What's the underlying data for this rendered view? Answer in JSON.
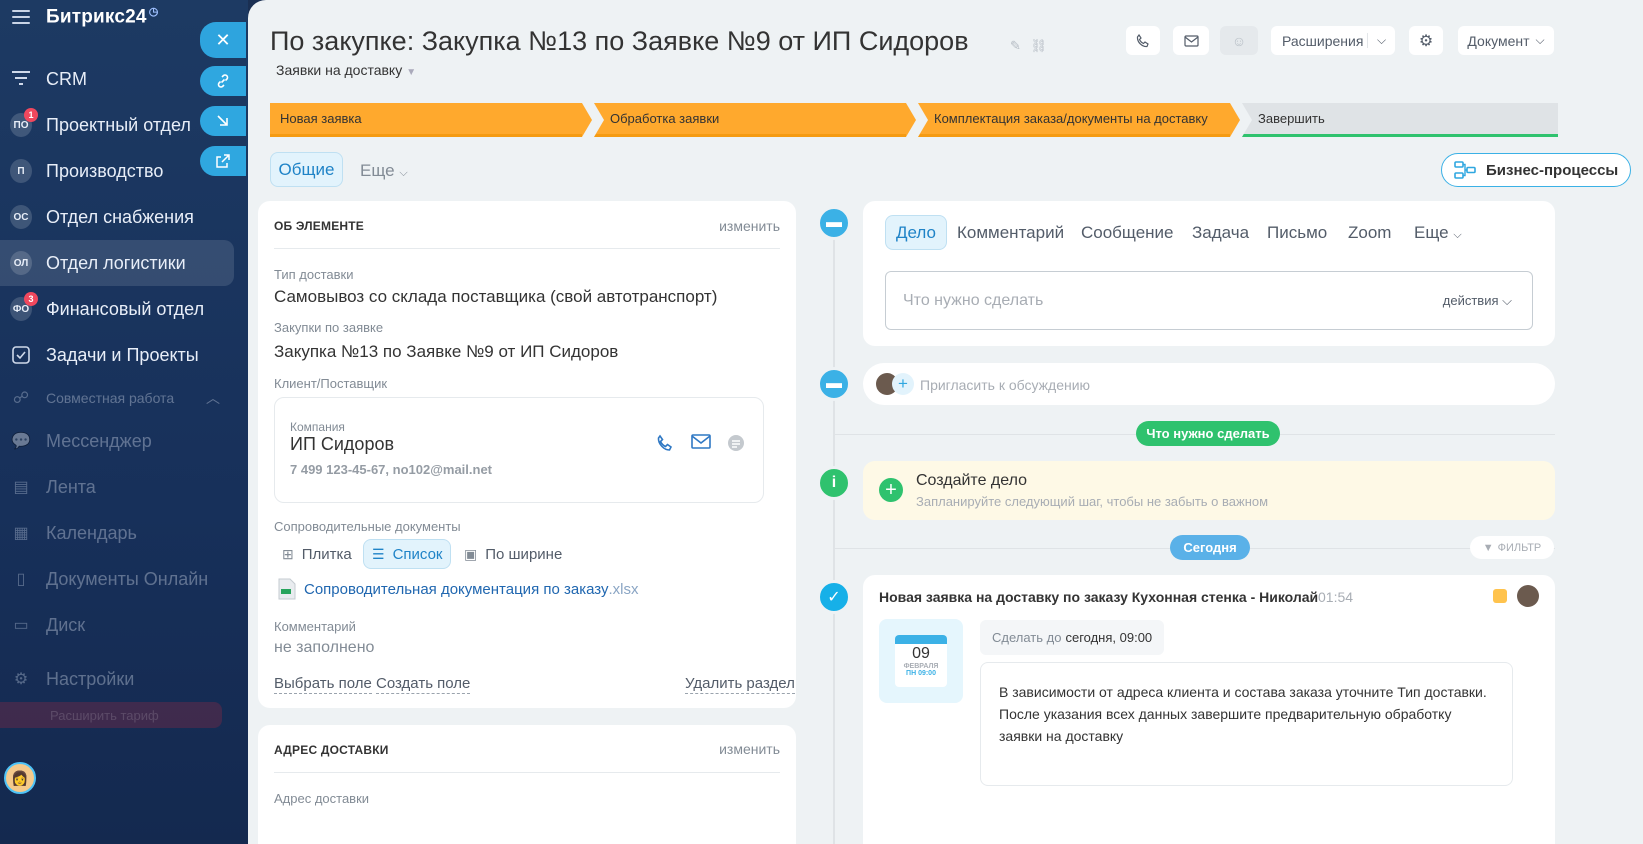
{
  "sidebar": {
    "brand": "Битрикс24",
    "items": [
      {
        "label": "CRM",
        "icon": "funnel-icon",
        "badge": "",
        "count": ""
      },
      {
        "label": "Проектный отдел",
        "icon": "",
        "badge": "ПО",
        "count": "1"
      },
      {
        "label": "Производство",
        "icon": "",
        "badge": "П",
        "count": ""
      },
      {
        "label": "Отдел снабжения",
        "icon": "",
        "badge": "ОС",
        "count": ""
      },
      {
        "label": "Отдел логистики",
        "icon": "",
        "badge": "ОЛ",
        "count": ""
      },
      {
        "label": "Финансовый отдел",
        "icon": "",
        "badge": "ФО",
        "count": "3"
      },
      {
        "label": "Задачи и Проекты",
        "icon": "checkbox-icon",
        "badge": "",
        "count": ""
      }
    ],
    "section": "Совместная работа",
    "dim_items": [
      "Мессенджер",
      "Лента",
      "Календарь",
      "Документы Онлайн",
      "Диск"
    ],
    "settings": "Настройки",
    "tariff": "Расширить тариф"
  },
  "header": {
    "title": "По закупке: Закупка №13 по Заявке №9 от ИП Сидоров",
    "category": "Заявки на доставку",
    "extensions": "Расширения",
    "document": "Документ"
  },
  "stages": [
    "Новая заявка",
    "Обработка заявки",
    "Комплектация заказа/документы на доставку",
    "Завершить"
  ],
  "tabs": {
    "general": "Общие",
    "more": "Еще"
  },
  "bp_button": "Бизнес-процессы",
  "about": {
    "heading": "ОБ ЭЛЕМЕНТЕ",
    "edit": "изменить",
    "delivery_type_label": "Тип доставки",
    "delivery_type_value": "Самовывоз со склада поставщика (свой автотранспорт)",
    "purchase_label": "Закупки по заявке",
    "purchase_value": "Закупка №13 по Заявке №9 от ИП Сидоров",
    "client_label": "Клиент/Поставщик",
    "company_label": "Компания",
    "company_name": "ИП Сидоров",
    "company_contacts": "7 499 123-45-67, no102@mail.net",
    "docs_label": "Сопроводительные документы",
    "view_tile": "Плитка",
    "view_list": "Список",
    "view_wide": "По ширине",
    "file_name": "Сопроводительная документация по заказу",
    "file_ext": ".xlsx",
    "comment_label": "Комментарий",
    "comment_value": "не заполнено",
    "select_field": "Выбрать поле",
    "create_field": "Создать поле",
    "delete_section": "Удалить раздел"
  },
  "address": {
    "heading": "АДРЕС ДОСТАВКИ",
    "edit": "изменить",
    "label": "Адрес доставки"
  },
  "activity": {
    "tabs": [
      "Дело",
      "Комментарий",
      "Сообщение",
      "Задача",
      "Письмо",
      "Zoom",
      "Еще"
    ],
    "placeholder": "Что нужно сделать",
    "actions": "действия",
    "invite": "Пригласить к обсуждению",
    "todo_pill": "Что нужно сделать",
    "create_title": "Создайте дело",
    "create_sub": "Запланируйте следующий шаг, чтобы не забыть о важном",
    "today_pill": "Сегодня",
    "filter": "ФИЛЬТР"
  },
  "task": {
    "title": "Новая заявка на доставку по заказу Кухонная стенка - Николай",
    "time": "01:54",
    "day": "09",
    "month": "ФЕВРАЛЯ",
    "weekday": "ПН 09:00",
    "deadline_label": "Сделать до",
    "deadline_value": "сегодня, 09:00",
    "text1": "В зависимости от адреса клиента и состава заказа уточните Тип доставки.",
    "text2": "После указания всех данных завершите предварительную обработку заявки на доставку"
  },
  "colors": {
    "accent": "#2fa7e0",
    "stage_done": "#ffa92d",
    "success": "#2fc26e"
  }
}
